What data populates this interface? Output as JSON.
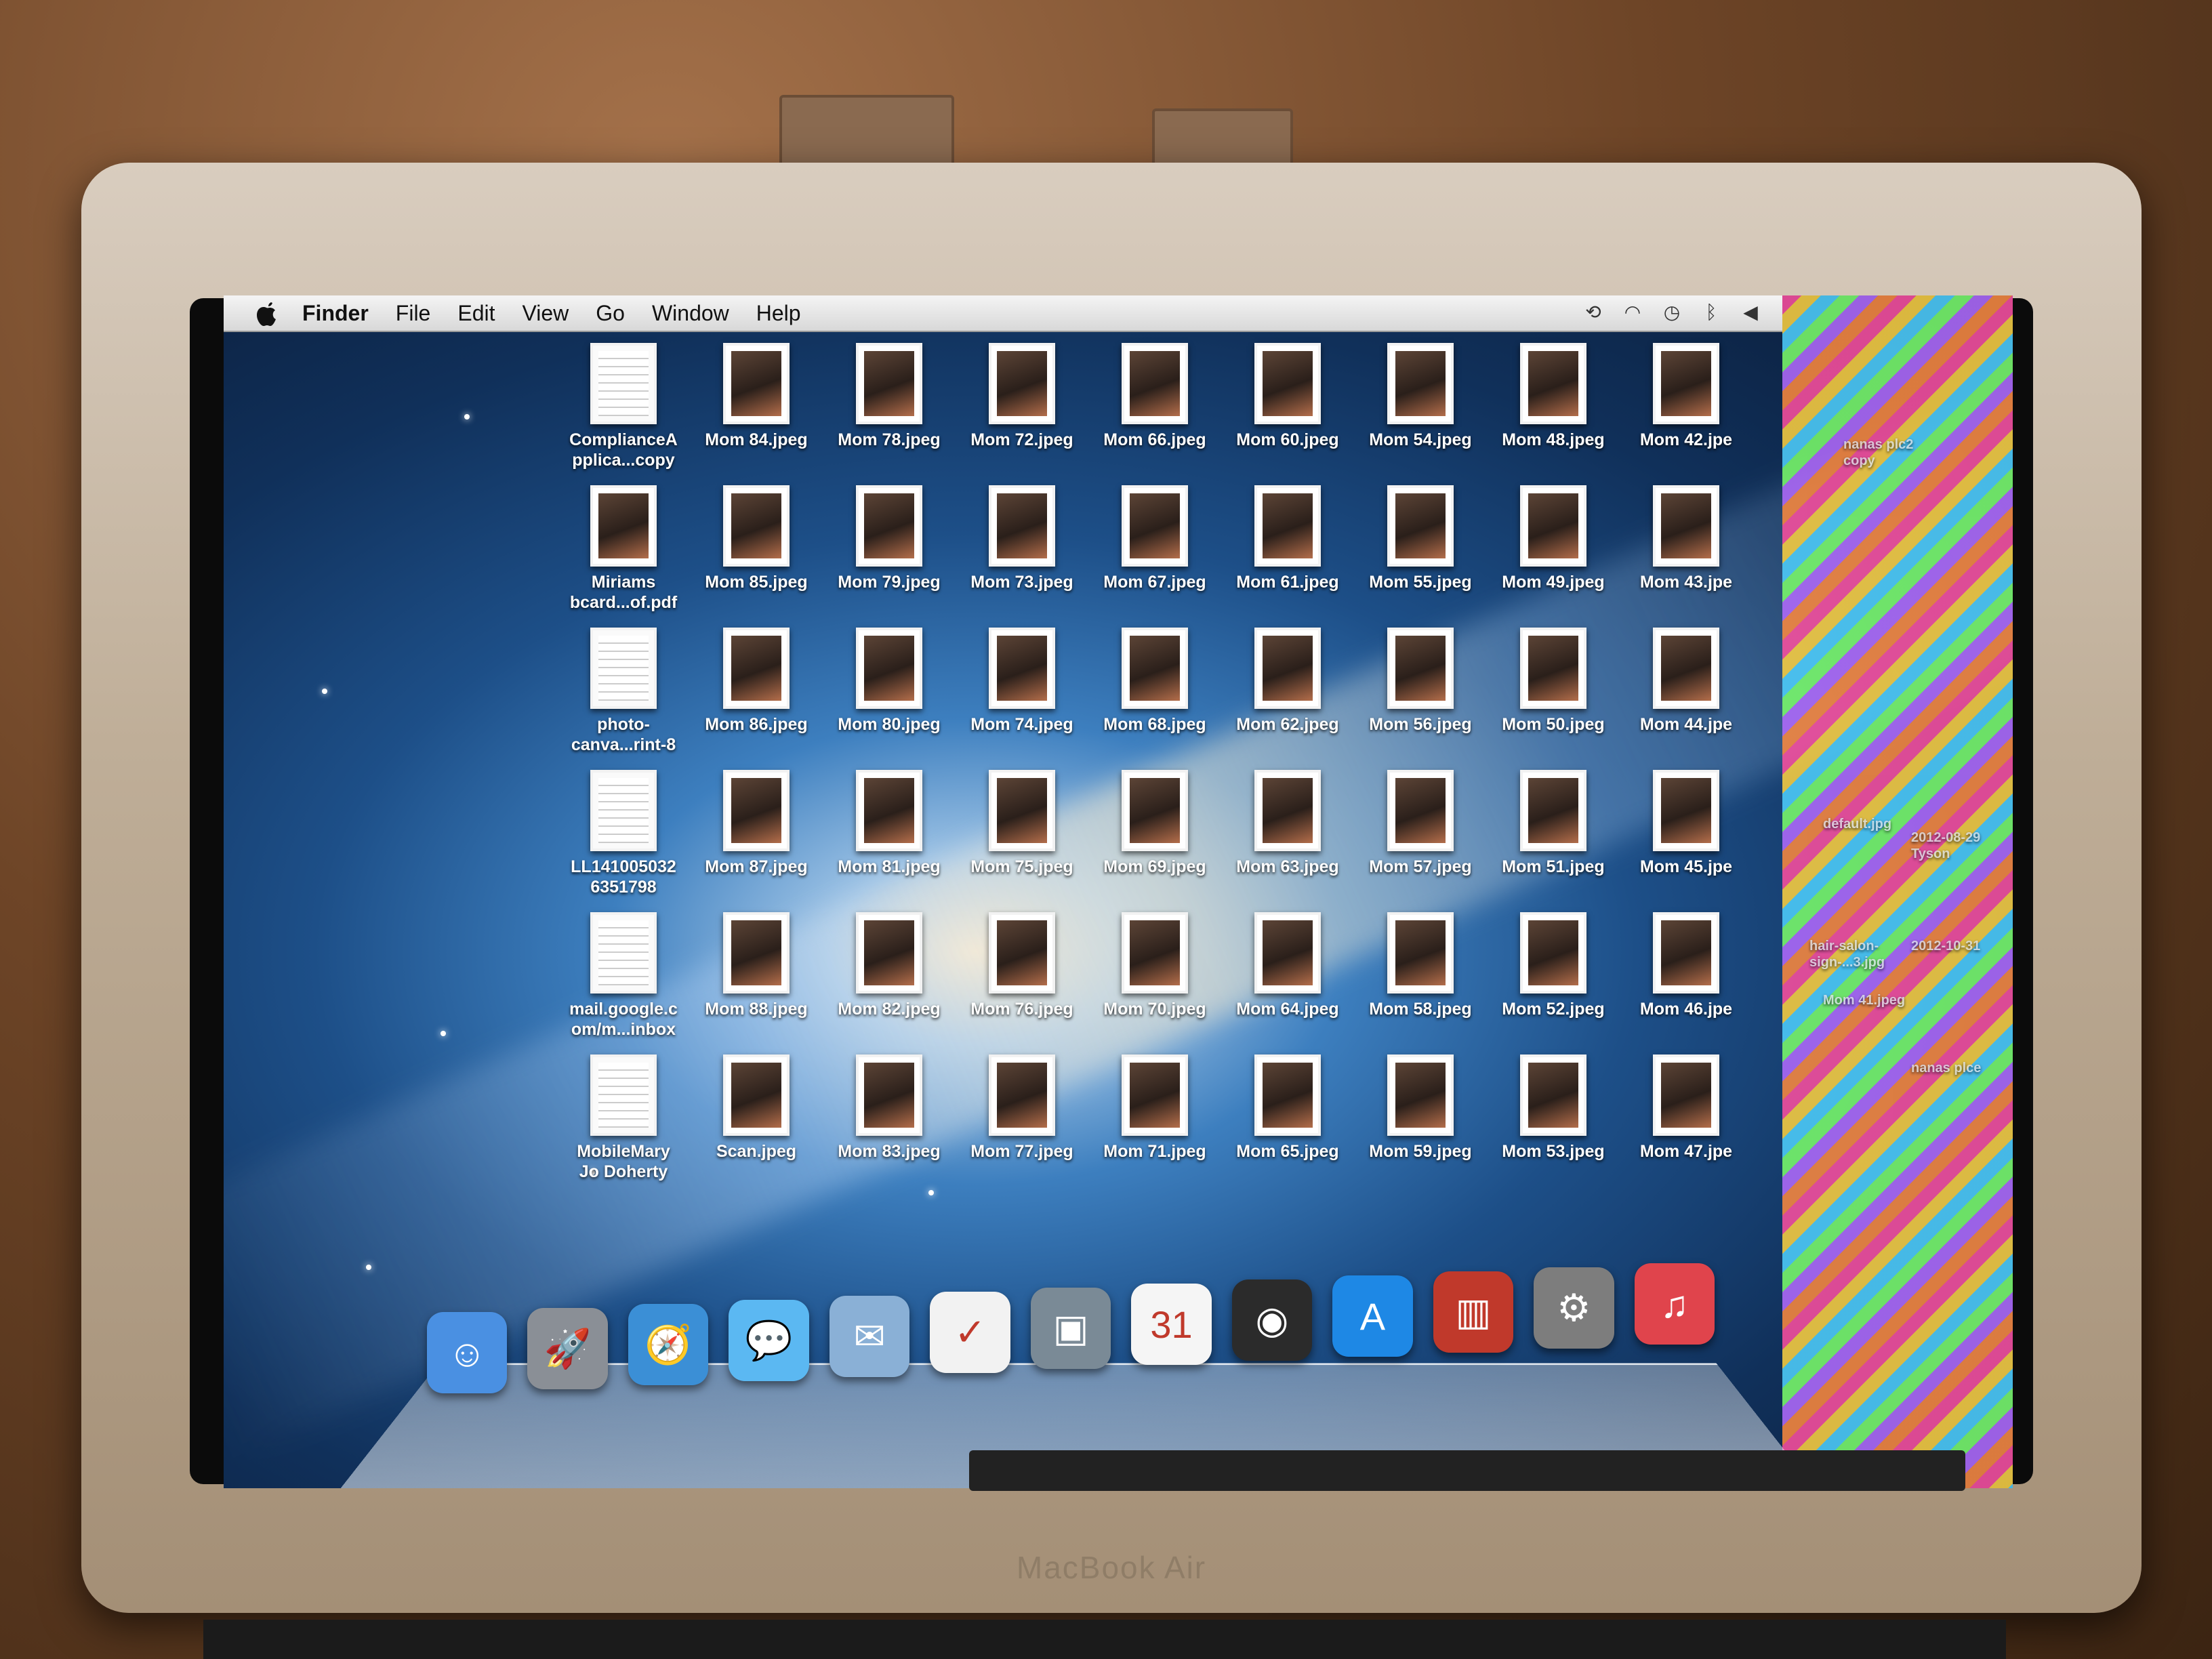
{
  "menubar": {
    "app_name": "Finder",
    "items": [
      "File",
      "Edit",
      "View",
      "Go",
      "Window",
      "Help"
    ]
  },
  "status_icons": [
    "time-machine-icon",
    "wifi-icon",
    "clock-icon",
    "bluetooth-icon",
    "volume-icon"
  ],
  "laptop_brand": "MacBook Air",
  "desktop_icons": [
    {
      "label": "ComplianceA\npplica...copy",
      "kind": "doc"
    },
    {
      "label": "Mom 84.jpeg",
      "kind": "photo"
    },
    {
      "label": "Mom 78.jpeg",
      "kind": "photo"
    },
    {
      "label": "Mom 72.jpeg",
      "kind": "photo"
    },
    {
      "label": "Mom 66.jpeg",
      "kind": "photo"
    },
    {
      "label": "Mom 60.jpeg",
      "kind": "photo"
    },
    {
      "label": "Mom 54.jpeg",
      "kind": "photo"
    },
    {
      "label": "Mom 48.jpeg",
      "kind": "photo"
    },
    {
      "label": "Mom 42.jpe",
      "kind": "photo"
    },
    {
      "label": "Miriams\nbcard...of.pdf",
      "kind": "photo"
    },
    {
      "label": "Mom 85.jpeg",
      "kind": "photo"
    },
    {
      "label": "Mom 79.jpeg",
      "kind": "photo"
    },
    {
      "label": "Mom 73.jpeg",
      "kind": "photo"
    },
    {
      "label": "Mom 67.jpeg",
      "kind": "photo"
    },
    {
      "label": "Mom 61.jpeg",
      "kind": "photo"
    },
    {
      "label": "Mom 55.jpeg",
      "kind": "photo"
    },
    {
      "label": "Mom 49.jpeg",
      "kind": "photo"
    },
    {
      "label": "Mom 43.jpe",
      "kind": "photo"
    },
    {
      "label": "photo-\ncanva...rint-8",
      "kind": "doc"
    },
    {
      "label": "Mom 86.jpeg",
      "kind": "photo"
    },
    {
      "label": "Mom 80.jpeg",
      "kind": "photo"
    },
    {
      "label": "Mom 74.jpeg",
      "kind": "photo"
    },
    {
      "label": "Mom 68.jpeg",
      "kind": "photo"
    },
    {
      "label": "Mom 62.jpeg",
      "kind": "photo"
    },
    {
      "label": "Mom 56.jpeg",
      "kind": "photo"
    },
    {
      "label": "Mom 50.jpeg",
      "kind": "photo"
    },
    {
      "label": "Mom 44.jpe",
      "kind": "photo"
    },
    {
      "label": "LL141005032\n6351798",
      "kind": "doc"
    },
    {
      "label": "Mom 87.jpeg",
      "kind": "photo"
    },
    {
      "label": "Mom 81.jpeg",
      "kind": "photo"
    },
    {
      "label": "Mom 75.jpeg",
      "kind": "photo"
    },
    {
      "label": "Mom 69.jpeg",
      "kind": "photo"
    },
    {
      "label": "Mom 63.jpeg",
      "kind": "photo"
    },
    {
      "label": "Mom 57.jpeg",
      "kind": "photo"
    },
    {
      "label": "Mom 51.jpeg",
      "kind": "photo"
    },
    {
      "label": "Mom 45.jpe",
      "kind": "photo"
    },
    {
      "label": "mail.google.c\nom/m...inbox",
      "kind": "doc"
    },
    {
      "label": "Mom 88.jpeg",
      "kind": "photo"
    },
    {
      "label": "Mom 82.jpeg",
      "kind": "photo"
    },
    {
      "label": "Mom 76.jpeg",
      "kind": "photo"
    },
    {
      "label": "Mom 70.jpeg",
      "kind": "photo"
    },
    {
      "label": "Mom 64.jpeg",
      "kind": "photo"
    },
    {
      "label": "Mom 58.jpeg",
      "kind": "photo"
    },
    {
      "label": "Mom 52.jpeg",
      "kind": "photo"
    },
    {
      "label": "Mom 46.jpe",
      "kind": "photo"
    },
    {
      "label": "MobileMary\nJo Doherty",
      "kind": "doc"
    },
    {
      "label": "Scan.jpeg",
      "kind": "photo"
    },
    {
      "label": "Mom 83.jpeg",
      "kind": "photo"
    },
    {
      "label": "Mom 77.jpeg",
      "kind": "photo"
    },
    {
      "label": "Mom 71.jpeg",
      "kind": "photo"
    },
    {
      "label": "Mom 65.jpeg",
      "kind": "photo"
    },
    {
      "label": "Mom 59.jpeg",
      "kind": "photo"
    },
    {
      "label": "Mom 53.jpeg",
      "kind": "photo"
    },
    {
      "label": "Mom 47.jpe",
      "kind": "photo"
    }
  ],
  "glitch_labels": [
    "nanas plc2\ncopy",
    "Mom 41.jpeg",
    "default.jpg",
    "hair-salon-\nsign-...3.jpg",
    "2012-08-29\nTyson",
    "2012-10-31",
    "nanas plce"
  ],
  "dock": {
    "items": [
      {
        "name": "finder-dock-icon",
        "glyph": "☺",
        "color": "#4a90e2"
      },
      {
        "name": "launchpad-dock-icon",
        "glyph": "🚀",
        "color": "#8a8f96"
      },
      {
        "name": "safari-dock-icon",
        "glyph": "🧭",
        "color": "#3b8fd6"
      },
      {
        "name": "messages-dock-icon",
        "glyph": "💬",
        "color": "#5bb8f2"
      },
      {
        "name": "mail-dock-icon",
        "glyph": "✉",
        "color": "#8ab0d6"
      },
      {
        "name": "reminders-dock-icon",
        "glyph": "✓",
        "color": "#f2f2f2"
      },
      {
        "name": "preview-dock-icon",
        "glyph": "▣",
        "color": "#7a8a96"
      },
      {
        "name": "calendar-dock-icon",
        "glyph": "31",
        "color": "#f5f5f5"
      },
      {
        "name": "facetime-dock-icon",
        "glyph": "◉",
        "color": "#2b2b2b"
      },
      {
        "name": "app-store-dock-icon",
        "glyph": "A",
        "color": "#1e88e5"
      },
      {
        "name": "photo-booth-dock-icon",
        "glyph": "▥",
        "color": "#c0392b"
      },
      {
        "name": "system-preferences-dock-icon",
        "glyph": "⚙",
        "color": "#7d7d7d"
      },
      {
        "name": "itunes-dock-icon",
        "glyph": "♫",
        "color": "#e0444c"
      }
    ]
  },
  "colors": {
    "menubar_bg": "#e6e6e6",
    "label_text": "#ffffff"
  }
}
